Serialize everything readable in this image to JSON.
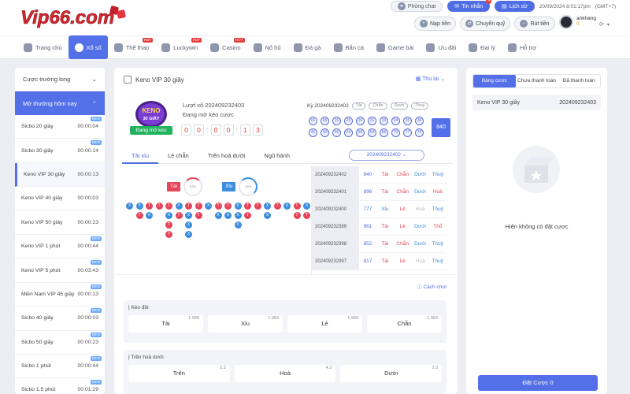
{
  "header": {
    "logo_text": "Vip66.com",
    "top_buttons": [
      {
        "label": "Phòng chat"
      },
      {
        "label": "Tin nhắn",
        "badge": "4"
      },
      {
        "label": "Lịch sử"
      }
    ],
    "datetime": "20/09/2024 8:01:17pm",
    "timezone": "(GMT+7)",
    "action_buttons": [
      {
        "label": "Nạp tiền"
      },
      {
        "label": "Chuyển quỹ"
      },
      {
        "label": "Rút tiền"
      }
    ],
    "username": "ankhang",
    "balance": "0"
  },
  "nav": [
    {
      "label": "Trang chủ",
      "hot": false
    },
    {
      "label": "Xổ số",
      "hot": false,
      "active": true
    },
    {
      "label": "Thể thao",
      "hot": true
    },
    {
      "label": "Luckywin",
      "hot": true
    },
    {
      "label": "Casino",
      "hot": true
    },
    {
      "label": "Nổ hũ",
      "hot": false
    },
    {
      "label": "Đá gà",
      "hot": false
    },
    {
      "label": "Bắn cá",
      "hot": false
    },
    {
      "label": "Game bài",
      "hot": false
    },
    {
      "label": "Ưu đãi",
      "hot": false
    },
    {
      "label": "Đại lý",
      "hot": false
    },
    {
      "label": "Hỗ trợ",
      "hot": false
    }
  ],
  "hot_label": "HOT",
  "new_label": "NEW",
  "sidebar": {
    "section1": "Cược trường long",
    "section2": "Mở thưởng hôm nay",
    "items": [
      {
        "name": "Sicbo 20 giây",
        "time": "00:00:04"
      },
      {
        "name": "Sicbo 30 giây",
        "time": "00:00:14"
      },
      {
        "name": "Keno VIP 30 giây",
        "time": "00:00:13",
        "selected": true
      },
      {
        "name": "Keno VIP 40 giây",
        "time": "00:00:03"
      },
      {
        "name": "Keno VIP 50 giây",
        "time": "00:00:23"
      },
      {
        "name": "Keno VIP 1 phút",
        "time": "00:00:44"
      },
      {
        "name": "Keno VIP 5 phút",
        "time": "00:03:43"
      },
      {
        "name": "Miền Nam VIP 45 giây",
        "time": "00:00:13"
      },
      {
        "name": "Sicbo 40 giây",
        "time": "00:00:03"
      },
      {
        "name": "Sicbo 50 giây",
        "time": "00:00:23"
      },
      {
        "name": "Sicbo 1 phút",
        "time": "00:00:44"
      },
      {
        "name": "Sicbo 1.5 phút",
        "time": "00:01:29"
      }
    ]
  },
  "game": {
    "title": "Keno VIP 30 giây",
    "thu_lai": "Thu lại",
    "logo_line1": "KENO",
    "logo_line2": "30 GIÂY",
    "status": "Đang mở kèo",
    "round": "Lượt xổ 202409232403",
    "round_status": "Đang mở kèo cược",
    "timer": [
      "0",
      "0",
      "0",
      "0",
      "1",
      "3"
    ],
    "ky": "Kỳ 202409232402",
    "ky_tags": [
      "Tài",
      "Chẵn",
      "Dưới",
      "Thuỷ"
    ],
    "balls": [
      "01",
      "06",
      "15",
      "25",
      "30",
      "31",
      "33",
      "34",
      "35",
      "36",
      "41",
      "43",
      "46",
      "54",
      "59",
      "64",
      "66",
      "70",
      "77",
      "78"
    ],
    "sum": "840",
    "tabs": [
      "Tài xỉu",
      "Lẻ chẵn",
      "Trên hoà dưới",
      "Ngũ hành"
    ],
    "dropdown": "202409232402",
    "stat_tai": "Tài",
    "stat_tai_pct": "51%",
    "stat_xiu": "Xỉu",
    "stat_xiu_pct": "49%",
    "road": [
      [
        "X",
        "T",
        "",
        "",
        "",
        "",
        "",
        "",
        "",
        "",
        "",
        "",
        "",
        "",
        "",
        "",
        "",
        "",
        ""
      ],
      [
        "",
        "",
        "",
        "",
        "",
        "",
        "",
        "",
        "",
        "",
        "",
        "",
        "",
        "",
        "",
        "",
        "",
        "",
        ""
      ]
    ],
    "road_cols": [
      [
        "X"
      ],
      [
        "X",
        "T"
      ],
      [
        "T",
        "X"
      ],
      [
        "T"
      ],
      [
        "T",
        "X",
        "T",
        "T"
      ],
      [
        "X",
        "T"
      ],
      [
        "T",
        "X",
        "X",
        "X"
      ],
      [
        "T",
        "T"
      ],
      [
        "X"
      ],
      [
        "T",
        "X"
      ],
      [
        "T",
        "X"
      ],
      [
        "X",
        "X",
        "X"
      ],
      [
        "T",
        "T"
      ],
      [
        "T"
      ],
      [
        "X",
        "X"
      ],
      [
        "T"
      ],
      [
        "X"
      ],
      [
        "T",
        "T"
      ],
      [
        "X",
        "T"
      ]
    ],
    "history": [
      {
        "id": "202409232402",
        "n": "840",
        "a": "Tài",
        "b": "Chẵn",
        "c": "Dưới",
        "d": "Thuỷ"
      },
      {
        "id": "202409232401",
        "n": "896",
        "a": "Tài",
        "b": "Chẵn",
        "c": "Dưới",
        "d": "Hoả"
      },
      {
        "id": "202409232400",
        "n": "777",
        "a": "Xỉu",
        "b": "Lẻ",
        "c": "Hoà",
        "d": "Thuỷ"
      },
      {
        "id": "202409232399",
        "n": "961",
        "a": "Tài",
        "b": "Lẻ",
        "c": "Dưới",
        "d": "Thổ"
      },
      {
        "id": "202409232398",
        "n": "852",
        "a": "Tài",
        "b": "Chẵn",
        "c": "Dưới",
        "d": "Thuỷ"
      },
      {
        "id": "202409232397",
        "n": "817",
        "a": "Tài",
        "b": "Lẻ",
        "c": "Hoà",
        "d": "Thuỷ"
      }
    ],
    "cach_choi": "Cách chơi",
    "keo_doi": {
      "title": "Kèo đôi",
      "options": [
        {
          "label": "Tài",
          "odd": "1.999"
        },
        {
          "label": "Xỉu",
          "odd": "1.959"
        },
        {
          "label": "Lẻ",
          "odd": "1.999"
        },
        {
          "label": "Chẵn",
          "odd": "1.959"
        }
      ]
    },
    "tren_hoa_duoi": {
      "title": "Trên hoà dưới",
      "options": [
        {
          "label": "Trên",
          "odd": "2.3"
        },
        {
          "label": "Hoà",
          "odd": "4.3"
        },
        {
          "label": "Dưới",
          "odd": "2.3"
        }
      ]
    }
  },
  "bet_panel": {
    "tabs": [
      "Bảng cược",
      "Chưa thanh toán",
      "Đã thanh toán"
    ],
    "game": "Keno VIP 30 giây",
    "round": "202409232403",
    "empty": "Hiện không có đặt cược",
    "place": "Đặt Cược 0"
  }
}
